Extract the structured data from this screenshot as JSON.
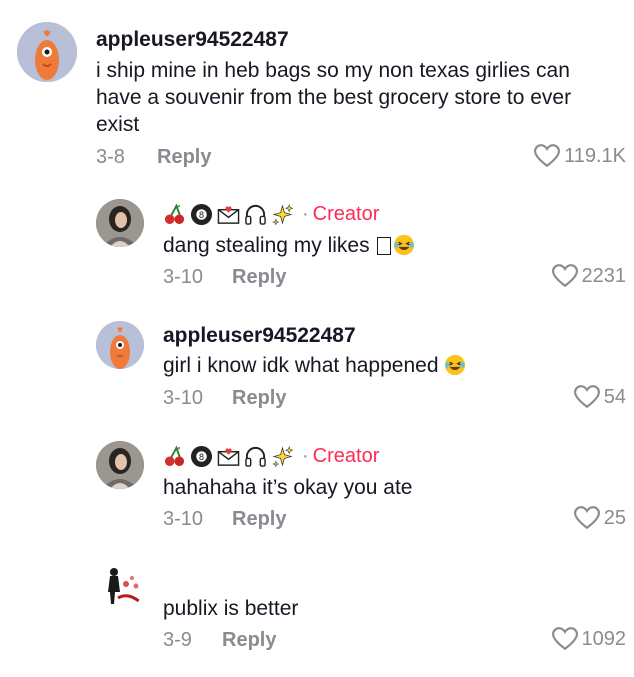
{
  "comments": [
    {
      "username": "appleuser94522487",
      "text": "i ship mine in heb bags so my non texas girlies can have a souvenir from the best grocery store to ever exist",
      "date": "3-8",
      "reply_label": "Reply",
      "likes": "119.1K",
      "avatar_icon": "bird-icon"
    },
    {
      "username_emojis": [
        "cherries-icon",
        "eight-ball-icon",
        "love-letter-icon",
        "headphones-icon",
        "sparkles-icon"
      ],
      "creator_label": "Creator",
      "text": "dang stealing my likes",
      "date": "3-10",
      "reply_label": "Reply",
      "likes": "2231",
      "avatar_icon": "creator-photo"
    },
    {
      "username": "appleuser94522487",
      "text": "girl i know idk what happened",
      "date": "3-10",
      "reply_label": "Reply",
      "likes": "54",
      "avatar_icon": "bird-icon"
    },
    {
      "username_emojis": [
        "cherries-icon",
        "eight-ball-icon",
        "love-letter-icon",
        "headphones-icon",
        "sparkles-icon"
      ],
      "creator_label": "Creator",
      "text": "hahahaha it’s okay you ate",
      "date": "3-10",
      "reply_label": "Reply",
      "likes": "25",
      "avatar_icon": "creator-photo"
    },
    {
      "username": "",
      "text": "publix is better",
      "date": "3-9",
      "reply_label": "Reply",
      "likes": "1092",
      "avatar_icon": "figure-art-avatar"
    }
  ],
  "colors": {
    "creator": "#fe2c55",
    "meta": "#8a8b91",
    "text": "#161823",
    "bird_bg": "#b9bfd7",
    "bird": "#f07a3a"
  }
}
